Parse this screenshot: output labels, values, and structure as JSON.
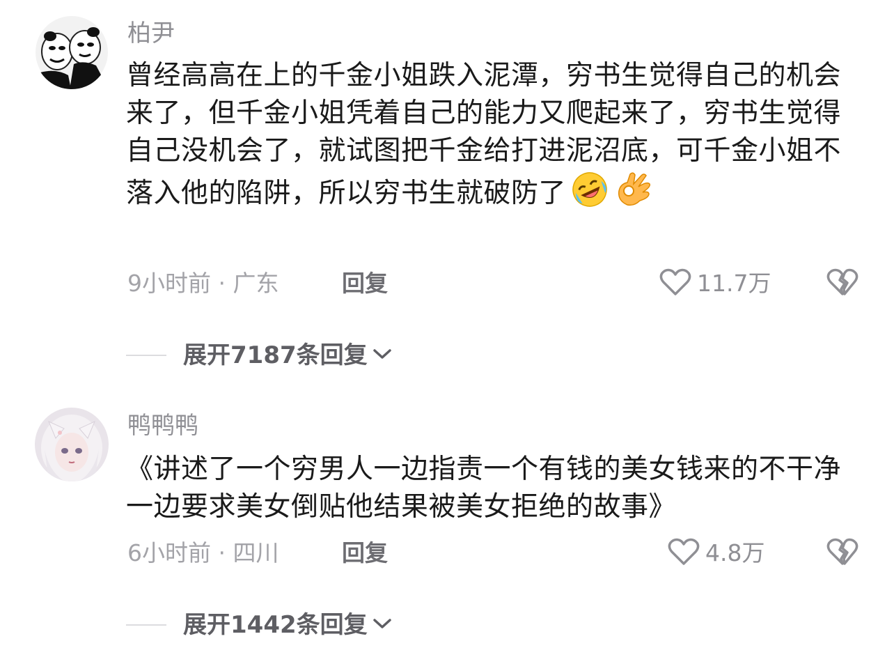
{
  "comments": [
    {
      "username": "柏尹",
      "avatar_icon": "meme-face-avatar",
      "text": "曾经高高在上的千金小姐跌入泥潭，穷书生觉得自己的机会来了，但千金小姐凭着自己的能力又爬起来了，穷书生觉得自己没机会了，就试图把千金给打进泥沼底，可千金小姐不落入他的陷阱，所以穷书生就破防了",
      "emojis": [
        "rofl-emoji",
        "ok-hand-emoji"
      ],
      "time_location": "9小时前 · 广东",
      "reply_label": "回复",
      "likes": "11.7万",
      "expand_label": "展开7187条回复"
    },
    {
      "username": "鸭鸭鸭",
      "avatar_icon": "anime-girl-avatar",
      "text": "《讲述了一个穷男人一边指责一个有钱的美女钱来的不干净一边要求美女倒贴他结果被美女拒绝的故事》",
      "emojis": [],
      "time_location": "6小时前 · 四川",
      "reply_label": "回复",
      "likes": "4.8万",
      "expand_label": "展开1442条回复"
    }
  ],
  "colors": {
    "username": "#8f8f94",
    "text": "#1a1a1a",
    "meta": "#a3a3a8",
    "expand": "#5e5e63"
  }
}
